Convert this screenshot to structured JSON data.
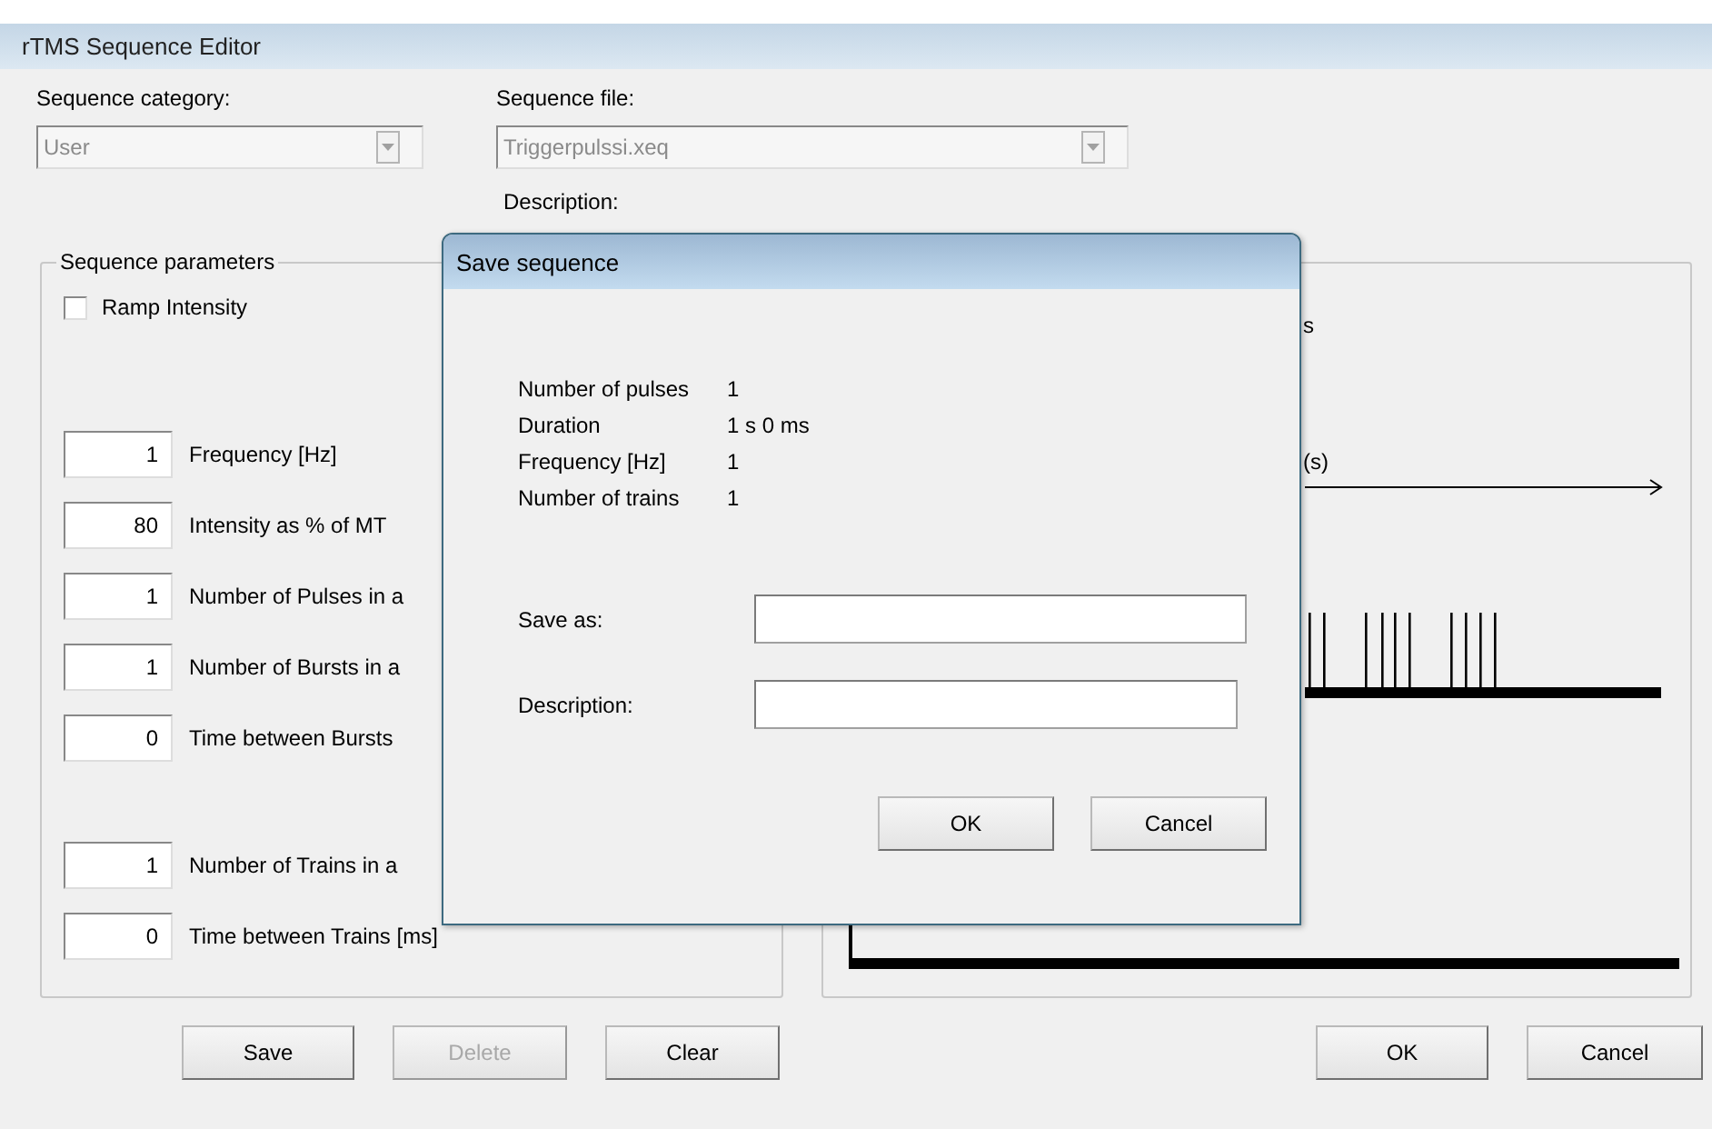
{
  "window": {
    "title": "rTMS Sequence Editor"
  },
  "sequence_category": {
    "label": "Sequence category:",
    "value": "User",
    "disabled": true
  },
  "sequence_file": {
    "label": "Sequence file:",
    "value": "Triggerpulssi.xeq",
    "disabled": true
  },
  "description_label": "Description:",
  "parameters": {
    "title": "Sequence parameters",
    "ramp": {
      "label": "Ramp Intensity",
      "checked": false
    },
    "row_groups": [
      [
        {
          "value": "1",
          "label": "Frequency [Hz]"
        },
        {
          "value": "80",
          "label": "Intensity as % of MT"
        },
        {
          "value": "1",
          "label": "Number of Pulses in a"
        },
        {
          "value": "1",
          "label": "Number of Bursts in a"
        },
        {
          "value": "0",
          "label": "Time between Bursts"
        }
      ],
      [
        {
          "value": "1",
          "label": "Number of Trains in a"
        },
        {
          "value": "0",
          "label": "Time between Trains [ms]"
        }
      ]
    ]
  },
  "preview": {
    "labels": [
      "s",
      "(s)"
    ]
  },
  "left_buttons": [
    {
      "label": "Save",
      "disabled": false
    },
    {
      "label": "Delete",
      "disabled": true
    },
    {
      "label": "Clear",
      "disabled": false
    }
  ],
  "right_buttons": [
    {
      "label": "OK",
      "disabled": false
    },
    {
      "label": "Cancel",
      "disabled": false
    }
  ],
  "dialog": {
    "title": "Save sequence",
    "summary": [
      {
        "name": "Number of pulses",
        "value": "1"
      },
      {
        "name": "Duration",
        "value": "1 s 0 ms"
      },
      {
        "name": "Frequency [Hz]",
        "value": "1"
      },
      {
        "name": "Number of trains",
        "value": "1"
      }
    ],
    "fields": [
      {
        "label": "Save as:"
      },
      {
        "label": "Description:"
      }
    ],
    "buttons": [
      "OK",
      "Cancel"
    ]
  }
}
